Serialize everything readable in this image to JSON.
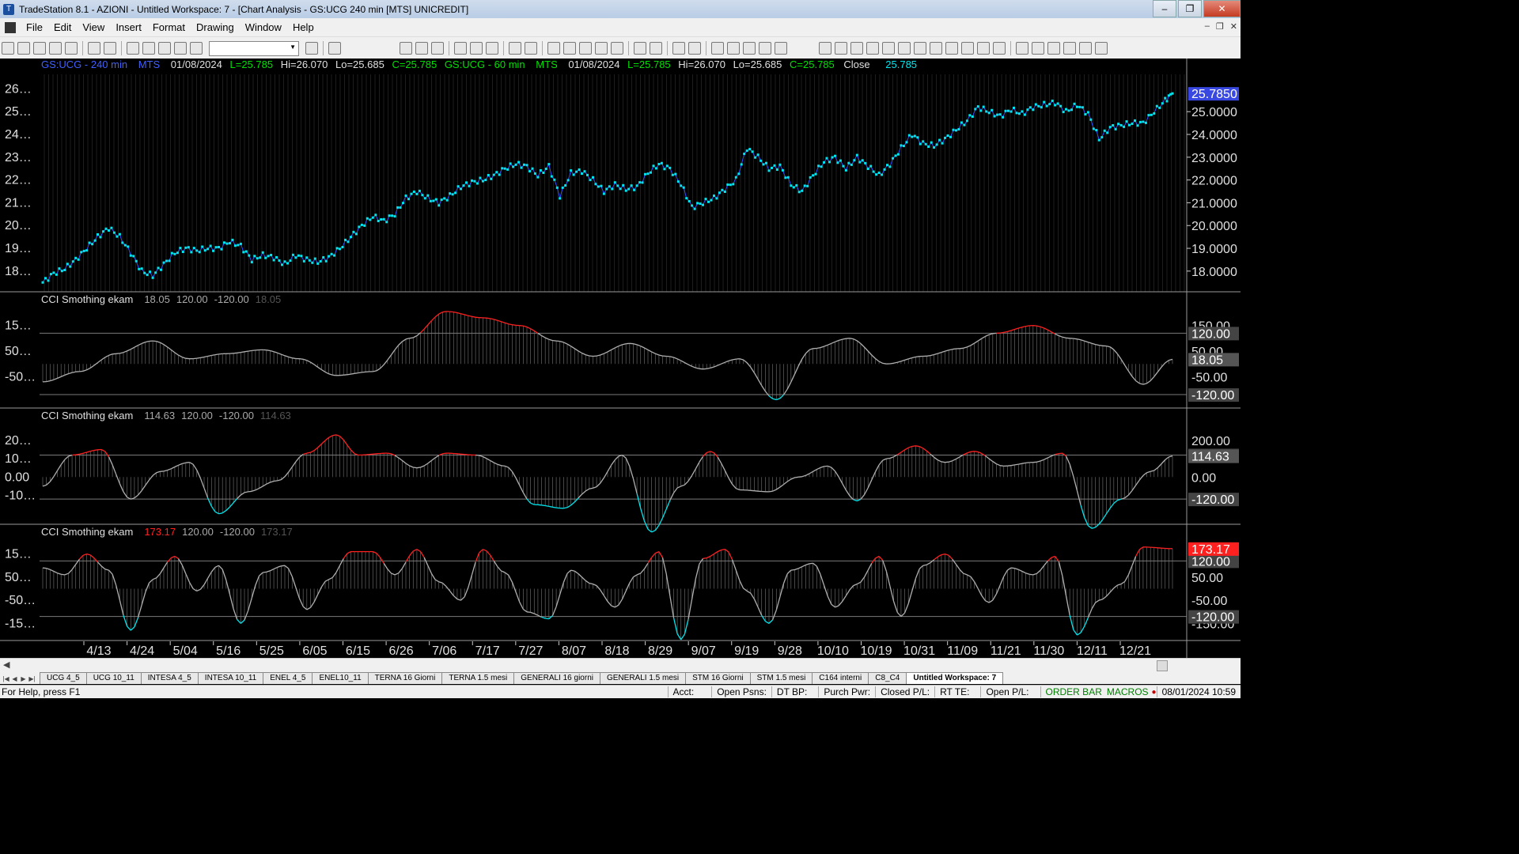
{
  "window": {
    "title": "TradeStation 8.1 - AZIONI - Untitled Workspace:  7 - [Chart Analysis - GS:UCG  240 min  [MTS] UNICREDIT]",
    "minimize": "–",
    "maximize": "❐",
    "close": "✕"
  },
  "menu": [
    "File",
    "Edit",
    "View",
    "Insert",
    "Format",
    "Drawing",
    "Window",
    "Help"
  ],
  "mdi": {
    "minimize": "–",
    "restore": "❐",
    "close": "✕"
  },
  "price_header": {
    "s1_symbol": "GS:UCG - 240 min",
    "s1_feed": "MTS",
    "s1_date": "01/08/2024",
    "s1_L": "L=25.785",
    "s1_Hi": "Hi=26.070",
    "s1_Lo": "Lo=25.685",
    "s1_C": "C=25.785",
    "s2_symbol": "GS:UCG - 60 min",
    "s2_feed": "MTS",
    "s2_date": "01/08/2024",
    "s2_L": "L=25.785",
    "s2_Hi": "Hi=26.070",
    "s2_Lo": "Lo=25.685",
    "s2_C": "C=25.785",
    "close_label": "Close",
    "close_val": "25.785"
  },
  "colors": {
    "price": "#00e5ee",
    "price_line": "#3050ff",
    "cci_line": "#b0b0b0",
    "cci_over": "#ff2020",
    "cci_under": "#00e5ee",
    "ref": "#7a7a7a",
    "text": "#e0e0e0",
    "s1_symbol": "#4060ff",
    "green": "#00e000"
  },
  "chart_data": [
    {
      "type": "line",
      "name": "GS:UCG price",
      "yticks_left": [
        "26…",
        "25…",
        "24…",
        "23…",
        "22…",
        "21…",
        "20…",
        "19…",
        "18…"
      ],
      "yticks_right": [
        "25.0000",
        "24.0000",
        "23.0000",
        "22.0000",
        "21.0000",
        "20.0000",
        "19.0000",
        "18.0000"
      ],
      "last_value_label": "25.7850",
      "ylim": [
        17.3,
        26.5
      ],
      "points": [
        [
          0,
          17.5
        ],
        [
          3,
          17.9
        ],
        [
          6,
          18.1
        ],
        [
          9,
          18.5
        ],
        [
          12,
          19.0
        ],
        [
          15,
          19.5
        ],
        [
          18,
          19.9
        ],
        [
          21,
          19.5
        ],
        [
          24,
          18.8
        ],
        [
          27,
          18.0
        ],
        [
          30,
          17.8
        ],
        [
          33,
          18.3
        ],
        [
          36,
          18.8
        ],
        [
          39,
          19.0
        ],
        [
          42,
          18.9
        ],
        [
          45,
          19.0
        ],
        [
          48,
          19.0
        ],
        [
          51,
          19.3
        ],
        [
          54,
          19.1
        ],
        [
          57,
          18.5
        ],
        [
          60,
          18.7
        ],
        [
          63,
          18.6
        ],
        [
          66,
          18.3
        ],
        [
          69,
          18.7
        ],
        [
          72,
          18.5
        ],
        [
          75,
          18.4
        ],
        [
          78,
          18.6
        ],
        [
          81,
          19.0
        ],
        [
          84,
          19.5
        ],
        [
          87,
          20.0
        ],
        [
          90,
          20.4
        ],
        [
          93,
          20.2
        ],
        [
          96,
          20.5
        ],
        [
          99,
          21.2
        ],
        [
          102,
          21.5
        ],
        [
          105,
          21.2
        ],
        [
          108,
          21.0
        ],
        [
          111,
          21.3
        ],
        [
          114,
          21.7
        ],
        [
          117,
          21.9
        ],
        [
          120,
          22.0
        ],
        [
          123,
          22.2
        ],
        [
          126,
          22.5
        ],
        [
          129,
          22.7
        ],
        [
          132,
          22.6
        ],
        [
          135,
          22.2
        ],
        [
          138,
          22.6
        ],
        [
          141,
          21.3
        ],
        [
          144,
          22.3
        ],
        [
          147,
          22.4
        ],
        [
          150,
          22.0
        ],
        [
          153,
          21.5
        ],
        [
          156,
          21.8
        ],
        [
          159,
          21.6
        ],
        [
          162,
          21.7
        ],
        [
          165,
          22.3
        ],
        [
          168,
          22.7
        ],
        [
          171,
          22.5
        ],
        [
          174,
          21.8
        ],
        [
          177,
          20.8
        ],
        [
          180,
          21.0
        ],
        [
          183,
          21.2
        ],
        [
          186,
          21.6
        ],
        [
          189,
          22.0
        ],
        [
          192,
          23.4
        ],
        [
          195,
          23.0
        ],
        [
          198,
          22.5
        ],
        [
          201,
          22.6
        ],
        [
          204,
          21.8
        ],
        [
          207,
          21.5
        ],
        [
          210,
          22.2
        ],
        [
          213,
          22.8
        ],
        [
          216,
          23.0
        ],
        [
          219,
          22.5
        ],
        [
          222,
          23.0
        ],
        [
          225,
          22.6
        ],
        [
          228,
          22.2
        ],
        [
          231,
          22.7
        ],
        [
          234,
          23.4
        ],
        [
          237,
          24.0
        ],
        [
          240,
          23.6
        ],
        [
          243,
          23.5
        ],
        [
          246,
          23.8
        ],
        [
          249,
          24.2
        ],
        [
          252,
          24.6
        ],
        [
          255,
          25.2
        ],
        [
          258,
          25.0
        ],
        [
          261,
          24.8
        ],
        [
          264,
          25.1
        ],
        [
          267,
          24.9
        ],
        [
          270,
          25.2
        ],
        [
          273,
          25.3
        ],
        [
          276,
          25.4
        ],
        [
          279,
          25.0
        ],
        [
          282,
          25.3
        ],
        [
          285,
          24.9
        ],
        [
          288,
          23.8
        ],
        [
          291,
          24.3
        ],
        [
          294,
          24.4
        ],
        [
          297,
          24.5
        ],
        [
          300,
          24.5
        ],
        [
          303,
          25.0
        ],
        [
          306,
          25.5
        ],
        [
          308,
          25.8
        ]
      ]
    },
    {
      "type": "area",
      "name": "CCI Smothing ekam",
      "label_value": "18.05",
      "level_hi": "120.00",
      "level_lo": "-120.00",
      "label_value_dim": "18.05",
      "yticks_left": [
        "15…",
        "50…",
        "-50…"
      ],
      "yticks_right": [
        "150.00",
        "50.00",
        "-50.00"
      ],
      "ref_levels": [
        120,
        -120
      ],
      "last_value_label": "18.05",
      "ylim": [
        -160,
        220
      ],
      "x": [
        0,
        10,
        20,
        30,
        40,
        50,
        60,
        70,
        80,
        90,
        100,
        110,
        120,
        130,
        140,
        150,
        160,
        170,
        180,
        190,
        200,
        210,
        220,
        230,
        240,
        250,
        260,
        270,
        280,
        290,
        300,
        308
      ],
      "values": [
        -70,
        -30,
        40,
        90,
        20,
        40,
        55,
        20,
        -45,
        -30,
        100,
        205,
        180,
        150,
        90,
        30,
        80,
        30,
        -20,
        20,
        -140,
        60,
        100,
        0,
        30,
        60,
        120,
        150,
        100,
        70,
        -80,
        18
      ]
    },
    {
      "type": "area",
      "name": "CCI Smothing ekam",
      "label_value": "114.63",
      "level_hi": "120.00",
      "level_lo": "-120.00",
      "label_value_dim": "114.63",
      "yticks_left": [
        "20…",
        "10…",
        "0.00",
        "-10…"
      ],
      "yticks_right": [
        "200.00",
        "0.00"
      ],
      "ref_levels": [
        120,
        -120
      ],
      "last_value_label": "114.63",
      "ylim": [
        -240,
        290
      ],
      "x": [
        0,
        8,
        16,
        24,
        32,
        40,
        48,
        56,
        64,
        72,
        80,
        86,
        94,
        102,
        110,
        118,
        126,
        134,
        142,
        150,
        158,
        166,
        174,
        182,
        190,
        198,
        206,
        214,
        222,
        230,
        238,
        246,
        254,
        262,
        270,
        278,
        286,
        294,
        302,
        308
      ],
      "values": [
        -50,
        120,
        150,
        -120,
        30,
        80,
        -200,
        -80,
        -20,
        130,
        230,
        120,
        130,
        50,
        130,
        120,
        60,
        -150,
        -170,
        -60,
        120,
        -300,
        -50,
        140,
        -70,
        -80,
        0,
        60,
        -130,
        100,
        170,
        80,
        140,
        60,
        80,
        130,
        -280,
        -120,
        30,
        115
      ]
    },
    {
      "type": "area",
      "name": "CCI Smothing ekam",
      "label_value": "173.17",
      "level_hi": "120.00",
      "level_lo": "-120.00",
      "label_value_dim": "173.17",
      "yticks_left": [
        "15…",
        "50…",
        "-50…",
        "-15…"
      ],
      "yticks_right": [
        "150.00",
        "50.00",
        "-50.00",
        "-150.00"
      ],
      "ref_levels": [
        120,
        -120
      ],
      "last_value_label": "173.17",
      "ylim": [
        -210,
        210
      ],
      "x": [
        0,
        6,
        12,
        18,
        24,
        30,
        36,
        42,
        48,
        54,
        60,
        66,
        72,
        78,
        84,
        90,
        96,
        102,
        108,
        114,
        120,
        126,
        132,
        138,
        144,
        150,
        156,
        162,
        168,
        174,
        180,
        186,
        192,
        198,
        204,
        210,
        216,
        222,
        228,
        234,
        240,
        246,
        252,
        258,
        264,
        270,
        276,
        282,
        288,
        294,
        300,
        308
      ],
      "values": [
        90,
        60,
        150,
        80,
        -180,
        40,
        140,
        -10,
        100,
        -150,
        70,
        100,
        -90,
        40,
        160,
        160,
        60,
        170,
        30,
        -50,
        170,
        70,
        -100,
        -130,
        80,
        20,
        -80,
        60,
        160,
        -220,
        130,
        170,
        -10,
        -150,
        80,
        110,
        -80,
        20,
        140,
        -120,
        100,
        150,
        60,
        -60,
        90,
        60,
        140,
        -200,
        -50,
        20,
        180,
        173
      ]
    }
  ],
  "time_axis": {
    "labels": [
      "4/13",
      "4/24",
      "5/04",
      "5/16",
      "5/25",
      "6/05",
      "6/15",
      "6/26",
      "7/06",
      "7/17",
      "7/27",
      "8/07",
      "8/18",
      "8/29",
      "9/07",
      "9/19",
      "9/28",
      "10/10",
      "10/19",
      "10/31",
      "11/09",
      "11/21",
      "11/30",
      "12/11",
      "12/21"
    ]
  },
  "tabs": [
    "UCG 4_5",
    "UCG 10_11",
    "INTESA 4_5",
    "INTESA 10_11",
    "ENEL 4_5",
    "ENEL10_11",
    "TERNA 16 Giorni",
    "TERNA 1.5 mesi",
    "GENERALI 16 giorni",
    "GENERALI 1.5 mesi",
    "STM 16 Giorni",
    "STM 1.5 mesi",
    "C164 interni",
    "C8_C4",
    "Untitled Workspace: 7"
  ],
  "tab_active_index": 14,
  "status": {
    "help": "For Help, press F1",
    "acct": "Acct:",
    "open_psns": "Open Psns:",
    "dt_bp": "DT BP:",
    "purch_pwr": "Purch Pwr:",
    "closed_pl": "Closed P/L:",
    "rt_te": "RT TE:",
    "open_pl": "Open P/L:",
    "order_bar": "ORDER BAR",
    "macros": "MACROS",
    "datetime": "08/01/2024 10:59"
  }
}
